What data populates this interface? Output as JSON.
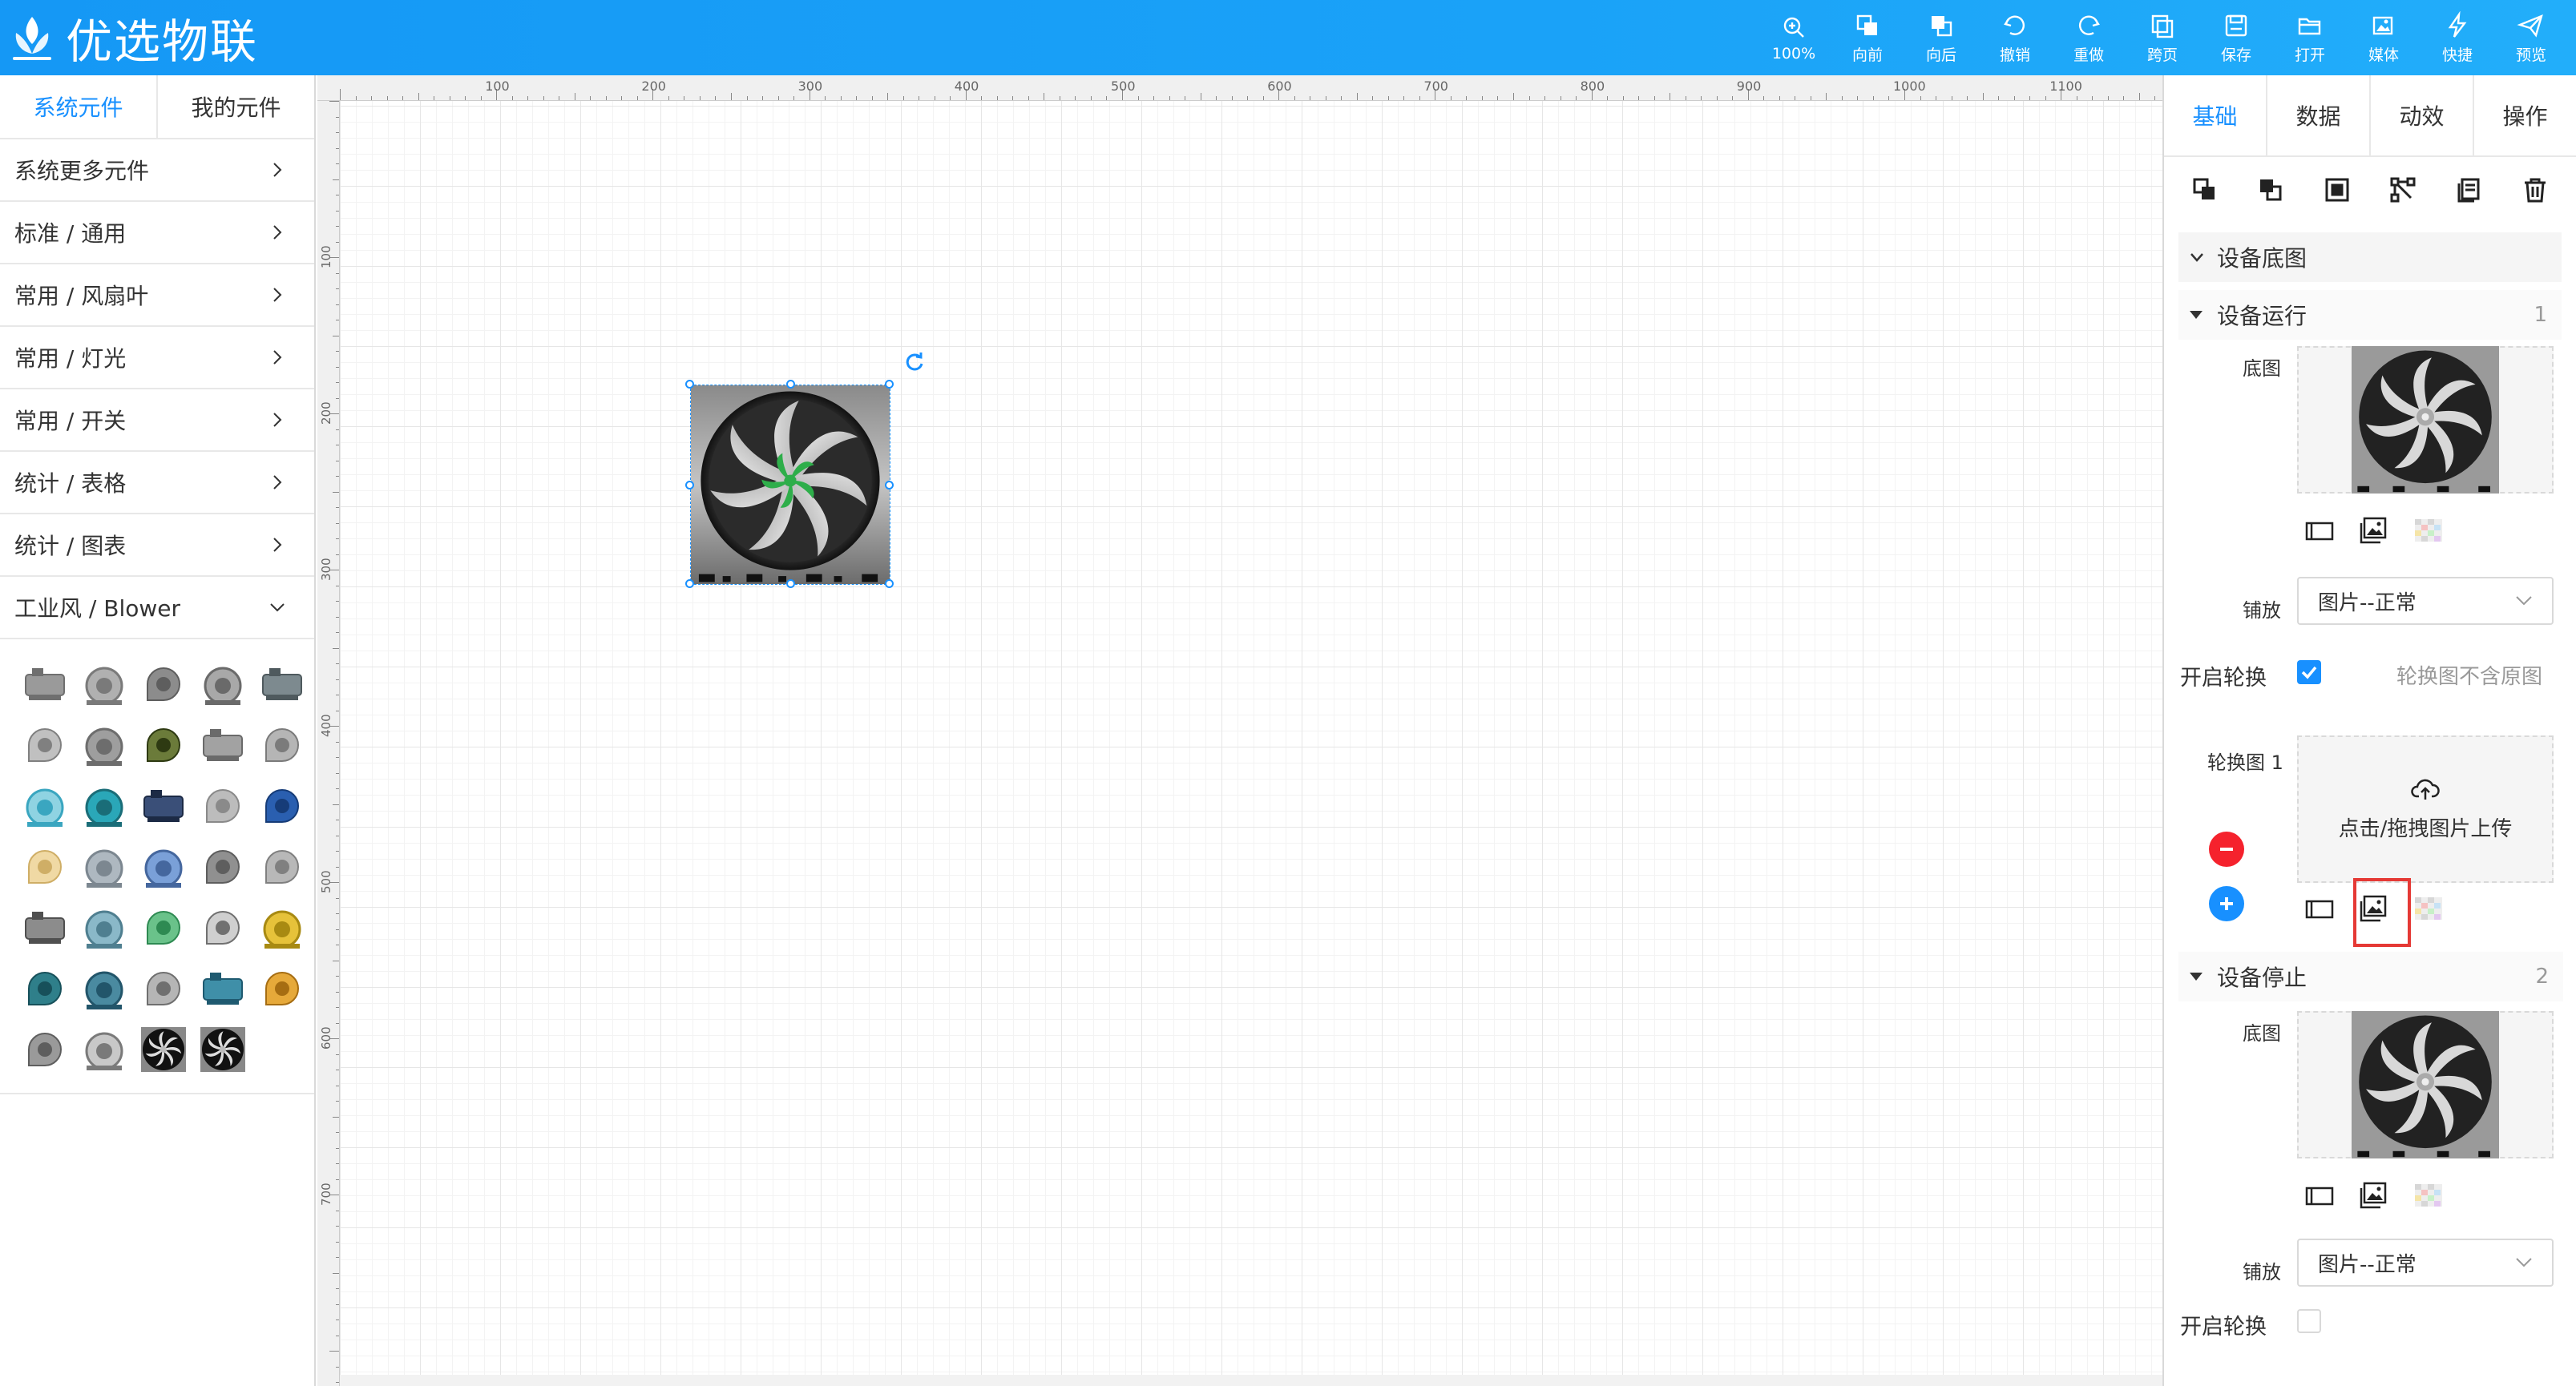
{
  "brand": {
    "name": "优选物联"
  },
  "toolbar": [
    {
      "label": "100%",
      "icon": "zoom-in-icon"
    },
    {
      "label": "向前",
      "icon": "bring-forward-icon"
    },
    {
      "label": "向后",
      "icon": "send-backward-icon"
    },
    {
      "label": "撤销",
      "icon": "undo-icon"
    },
    {
      "label": "重做",
      "icon": "redo-icon"
    },
    {
      "label": "跨页",
      "icon": "cross-page-icon"
    },
    {
      "label": "保存",
      "icon": "save-icon"
    },
    {
      "label": "打开",
      "icon": "folder-open-icon"
    },
    {
      "label": "媒体",
      "icon": "media-icon"
    },
    {
      "label": "快捷",
      "icon": "lightning-icon"
    },
    {
      "label": "预览",
      "icon": "send-icon"
    }
  ],
  "left": {
    "tabs": [
      "系统元件",
      "我的元件"
    ],
    "active_tab": 0,
    "categories": [
      "系统更多元件",
      "标准 / 通用",
      "常用 / 风扇叶",
      "常用 / 灯光",
      "常用 / 开关",
      "统计 / 表格",
      "统计 / 图表",
      "工业风 / Blower"
    ],
    "expanded_category": 7
  },
  "ruler": {
    "top_labels": [
      "100",
      "200",
      "300",
      "400",
      "500",
      "600",
      "700",
      "800",
      "900",
      "1000",
      "1100"
    ],
    "left_labels": [
      "100",
      "200",
      "300",
      "400",
      "500",
      "600",
      "700"
    ]
  },
  "right": {
    "tabs": [
      "基础",
      "数据",
      "动效",
      "操作"
    ],
    "active_tab": 0,
    "section_title": "设备底图",
    "group1": {
      "title": "设备运行",
      "index": "1"
    },
    "group2": {
      "title": "设备停止",
      "index": "2"
    },
    "labels": {
      "base_image": "底图",
      "tile": "铺放",
      "carousel": "开启轮换",
      "carousel_image": "轮换图 1",
      "carousel_hint": "轮换图不含原图",
      "upload": "点击/拖拽图片上传"
    },
    "tile_value": "图片--正常",
    "carousel_on_group1": true,
    "carousel_on_group2": false
  },
  "colors": {
    "accent": "#1890ff",
    "danger": "#f5222d",
    "highlight": "#e53935",
    "fan_center": "#2eae4a"
  }
}
